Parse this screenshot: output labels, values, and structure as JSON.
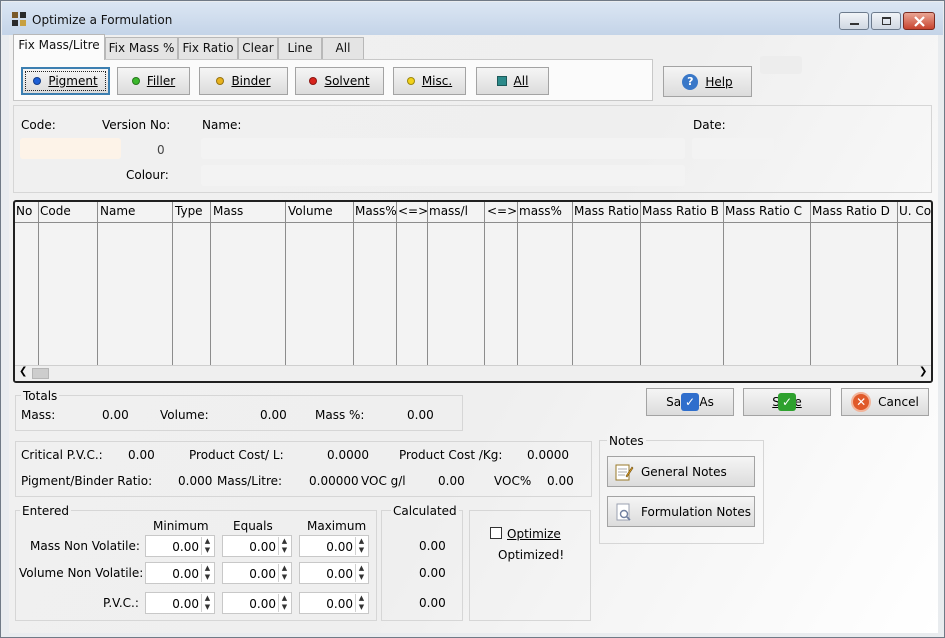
{
  "window": {
    "title": "Optimize a Formulation"
  },
  "tabs": [
    "Fix Mass/Litre",
    "Fix Mass %",
    "Fix Ratio",
    "Clear",
    "Line",
    "All"
  ],
  "filter_buttons": {
    "pigment": "Pigment",
    "filler": "Filler",
    "binder": "Binder",
    "solvent": "Solvent",
    "misc": "Misc.",
    "all": "All"
  },
  "help_label": "Help",
  "header": {
    "code_label": "Code:",
    "version_label": "Version No:",
    "version_value": "0",
    "name_label": "Name:",
    "date_label": "Date:",
    "colour_label": "Colour:"
  },
  "grid": {
    "columns": [
      "No",
      "Code",
      "Name",
      "Type",
      "Mass",
      "Volume",
      "Mass%",
      "<=>",
      "mass/l",
      "<=>",
      "mass%",
      "Mass Ratio",
      "Mass Ratio B",
      "Mass Ratio C",
      "Mass Ratio D",
      "U. Co"
    ]
  },
  "totals": {
    "title": "Totals",
    "mass_label": "Mass:",
    "mass_value": "0.00",
    "volume_label": "Volume:",
    "volume_value": "0.00",
    "masspct_label": "Mass %:",
    "masspct_value": "0.00"
  },
  "actions": {
    "save_as": "Save As",
    "save": "Save",
    "cancel": "Cancel"
  },
  "stats": {
    "cpvc_label": "Critical P.V.C.:",
    "cpvc_value": "0.00",
    "cost_l_label": "Product Cost/ L:",
    "cost_l_value": "0.0000",
    "cost_kg_label": "Product Cost /Kg:",
    "cost_kg_value": "0.0000",
    "pb_label": "Pigment/Binder Ratio:",
    "pb_value": "0.000",
    "ml_label": "Mass/Litre:",
    "ml_value": "0.00000",
    "voc_label": "VOC g/l",
    "voc_value": "0.00",
    "vocpct_label": "VOC%",
    "vocpct_value": "0.00"
  },
  "notes": {
    "title": "Notes",
    "general": "General Notes",
    "formulation": "Formulation Notes"
  },
  "entered": {
    "title": "Entered",
    "col_min": "Minimum",
    "col_eq": "Equals",
    "col_max": "Maximum",
    "rows": [
      {
        "label": "Mass Non Volatile:",
        "min": "0.00",
        "eq": "0.00",
        "max": "0.00"
      },
      {
        "label": "Volume Non Volatile:",
        "min": "0.00",
        "eq": "0.00",
        "max": "0.00"
      },
      {
        "label": "P.V.C.:",
        "min": "0.00",
        "eq": "0.00",
        "max": "0.00"
      }
    ]
  },
  "calculated": {
    "title": "Calculated",
    "values": [
      "0.00",
      "0.00",
      "0.00"
    ]
  },
  "optimize": {
    "checkbox_label": "Optimize",
    "status": "Optimized!"
  },
  "colors": {
    "pigment": "#1d5fd6",
    "filler": "#3bb82c",
    "binder": "#e8b21c",
    "solvent": "#d8231c",
    "misc": "#f2d21a",
    "all": "#2c8a8a"
  }
}
